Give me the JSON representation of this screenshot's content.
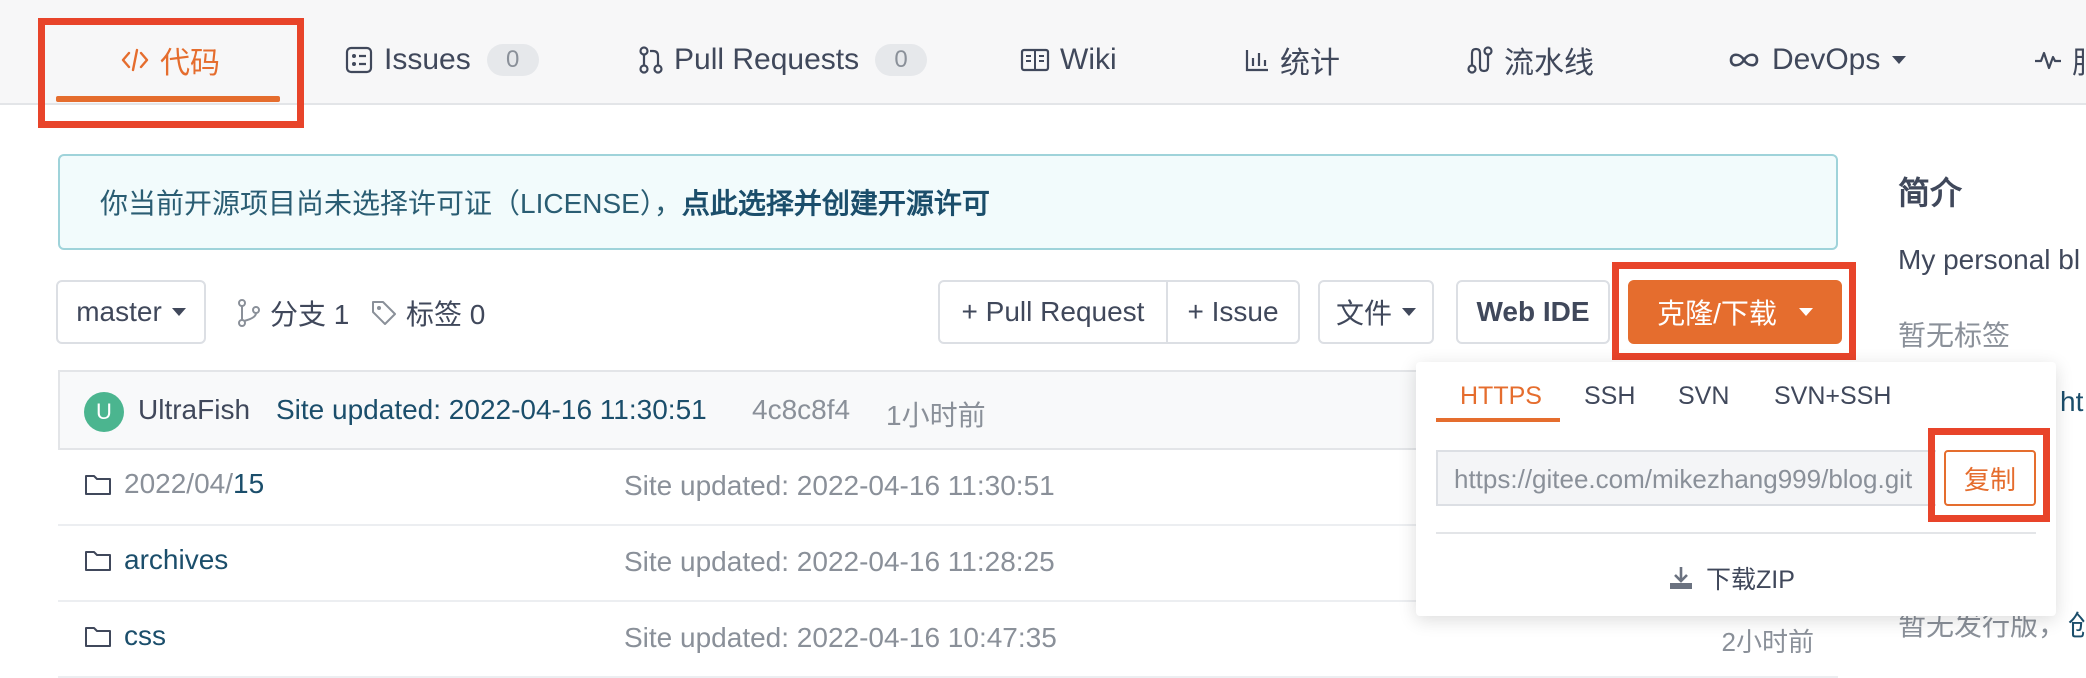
{
  "nav": {
    "tabs": [
      {
        "label": "代码",
        "icon": "code-icon"
      },
      {
        "label": "Issues",
        "count": "0",
        "icon": "issues-icon"
      },
      {
        "label": "Pull Requests",
        "count": "0",
        "icon": "pull-request-icon"
      },
      {
        "label": "Wiki",
        "icon": "book-icon"
      },
      {
        "label": "统计",
        "icon": "chart-icon"
      },
      {
        "label": "流水线",
        "icon": "pipeline-icon"
      },
      {
        "label": "DevOps",
        "icon": "infinity-icon"
      },
      {
        "label": "服",
        "icon": "pulse-icon"
      }
    ]
  },
  "notice": {
    "text": "你当前开源项目尚未选择许可证（LICENSE），",
    "link": "点此选择并创建开源许可"
  },
  "toolbar": {
    "branch": "master",
    "branches_label": "分支 1",
    "tags_label": "标签 0",
    "pull_request_btn": "+ Pull Request",
    "issue_btn": "+ Issue",
    "file_btn": "文件",
    "webide_btn": "Web IDE",
    "clone_btn": "克隆/下载"
  },
  "commit": {
    "avatar_letter": "U",
    "author": "UltraFish",
    "message": "Site updated: 2022-04-16 11:30:51",
    "hash": "4c8c8f4",
    "time": "1小时前"
  },
  "files": [
    {
      "name_prefix": "2022/04/",
      "name": "15",
      "message": "Site updated: 2022-04-16 11:30:51",
      "time": ""
    },
    {
      "name_prefix": "",
      "name": "archives",
      "message": "Site updated: 2022-04-16 11:28:25",
      "time": ""
    },
    {
      "name_prefix": "",
      "name": "css",
      "message": "Site updated: 2022-04-16 10:47:35",
      "time": "2小时前"
    }
  ],
  "clone_panel": {
    "protocols": [
      "HTTPS",
      "SSH",
      "SVN",
      "SVN+SSH"
    ],
    "url": "https://gitee.com/mikezhang999/blog.git",
    "copy_label": "复制",
    "download_zip": "下载ZIP"
  },
  "sidebar": {
    "title": "简介",
    "desc": "My personal bl",
    "no_tags": "暂无标签",
    "link": "ht",
    "no_release": "暂无发行版，",
    "create": "创"
  },
  "colors": {
    "accent": "#e56d2e",
    "highlight_box": "#e8442a",
    "link": "#1b4e6b",
    "avatar": "#4bb58f"
  }
}
